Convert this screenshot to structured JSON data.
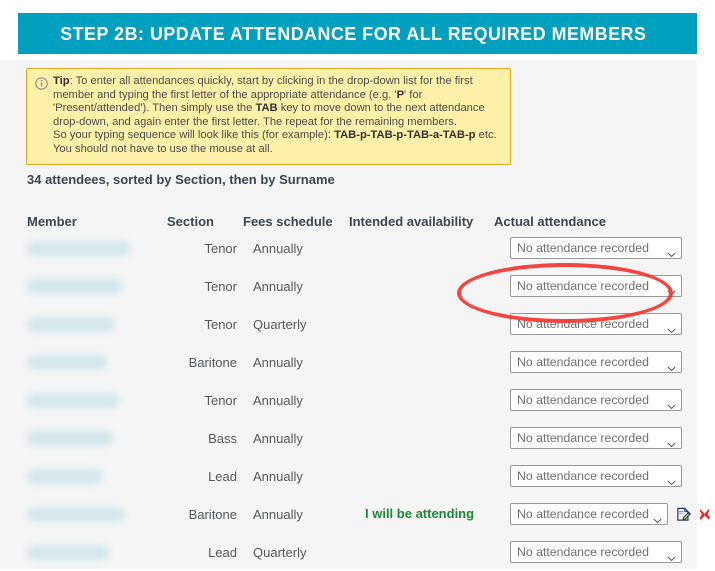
{
  "banner": {
    "title": "STEP 2B: UPDATE ATTENDANCE FOR ALL REQUIRED MEMBERS",
    "color": "#00a0be"
  },
  "tip": {
    "icon": "info-circle-icon",
    "label": "Tip",
    "line1_a": ": To enter all attendances quickly, start by clicking in the drop-down list for the first member and typing the first letter of the appropriate attendance (e.g. '",
    "line1_b": "P",
    "line1_c": "' for 'Present/attended'). Then simply use the ",
    "line1_d": "TAB",
    "line1_e": " key to move down to the next attendance drop-down, and again enter the first letter. The repeat for the remaining members.",
    "line2_a": "So your typing sequence will look like this (for example): ",
    "line2_b": "TAB-p-TAB-p-TAB-a-TAB-p",
    "line2_c": " etc.",
    "line3": "You should not have to use the mouse at all.",
    "bg": "#fdf0a8",
    "border": "#e5a823"
  },
  "summary": "34 attendees, sorted by Section, then by Surname",
  "table": {
    "headers": {
      "member": "Member",
      "section": "Section",
      "fees": "Fees schedule",
      "availability": "Intended availability",
      "actual": "Actual attendance"
    },
    "select_default": "No attendance recorded",
    "rows": [
      {
        "member": "",
        "blob_width": 104,
        "section": "Tenor",
        "fees": "Annually",
        "availability": "",
        "actual": "No attendance recorded",
        "icons": false
      },
      {
        "member": "",
        "blob_width": 96,
        "section": "Tenor",
        "fees": "Annually",
        "availability": "",
        "actual": "No attendance recorded",
        "icons": false
      },
      {
        "member": "",
        "blob_width": 88,
        "section": "Tenor",
        "fees": "Quarterly",
        "availability": "",
        "actual": "No attendance recorded",
        "icons": false
      },
      {
        "member": "",
        "blob_width": 80,
        "section": "Baritone",
        "fees": "Annually",
        "availability": "",
        "actual": "No attendance recorded",
        "icons": false
      },
      {
        "member": "",
        "blob_width": 92,
        "section": "Tenor",
        "fees": "Annually",
        "availability": "",
        "actual": "No attendance recorded",
        "icons": false
      },
      {
        "member": "",
        "blob_width": 86,
        "section": "Bass",
        "fees": "Annually",
        "availability": "",
        "actual": "No attendance recorded",
        "icons": false
      },
      {
        "member": "",
        "blob_width": 76,
        "section": "Lead",
        "fees": "Annually",
        "availability": "",
        "actual": "No attendance recorded",
        "icons": false
      },
      {
        "member": "",
        "blob_width": 98,
        "section": "Baritone",
        "fees": "Annually",
        "availability": "I will be attending",
        "actual": "No attendance recorded",
        "icons": true
      },
      {
        "member": "",
        "blob_width": 82,
        "section": "Lead",
        "fees": "Quarterly",
        "availability": "",
        "actual": "No attendance recorded",
        "icons": false
      }
    ]
  },
  "row_actions": {
    "edit_note_icon": "edit-note-icon",
    "delete_icon": "red-x-delete-icon"
  },
  "annotation": {
    "shape": "red-ellipse-highlight",
    "color": "#f5342e",
    "targets": "Actual attendance column header and first dropdown"
  },
  "colors": {
    "banner_teal": "#00a0be",
    "panel_bg": "#f5f5f5",
    "text": "#55595c",
    "heading": "#3d4650",
    "attending_green": "#1a8a32",
    "redaction_blue": "#d3e7ec"
  }
}
